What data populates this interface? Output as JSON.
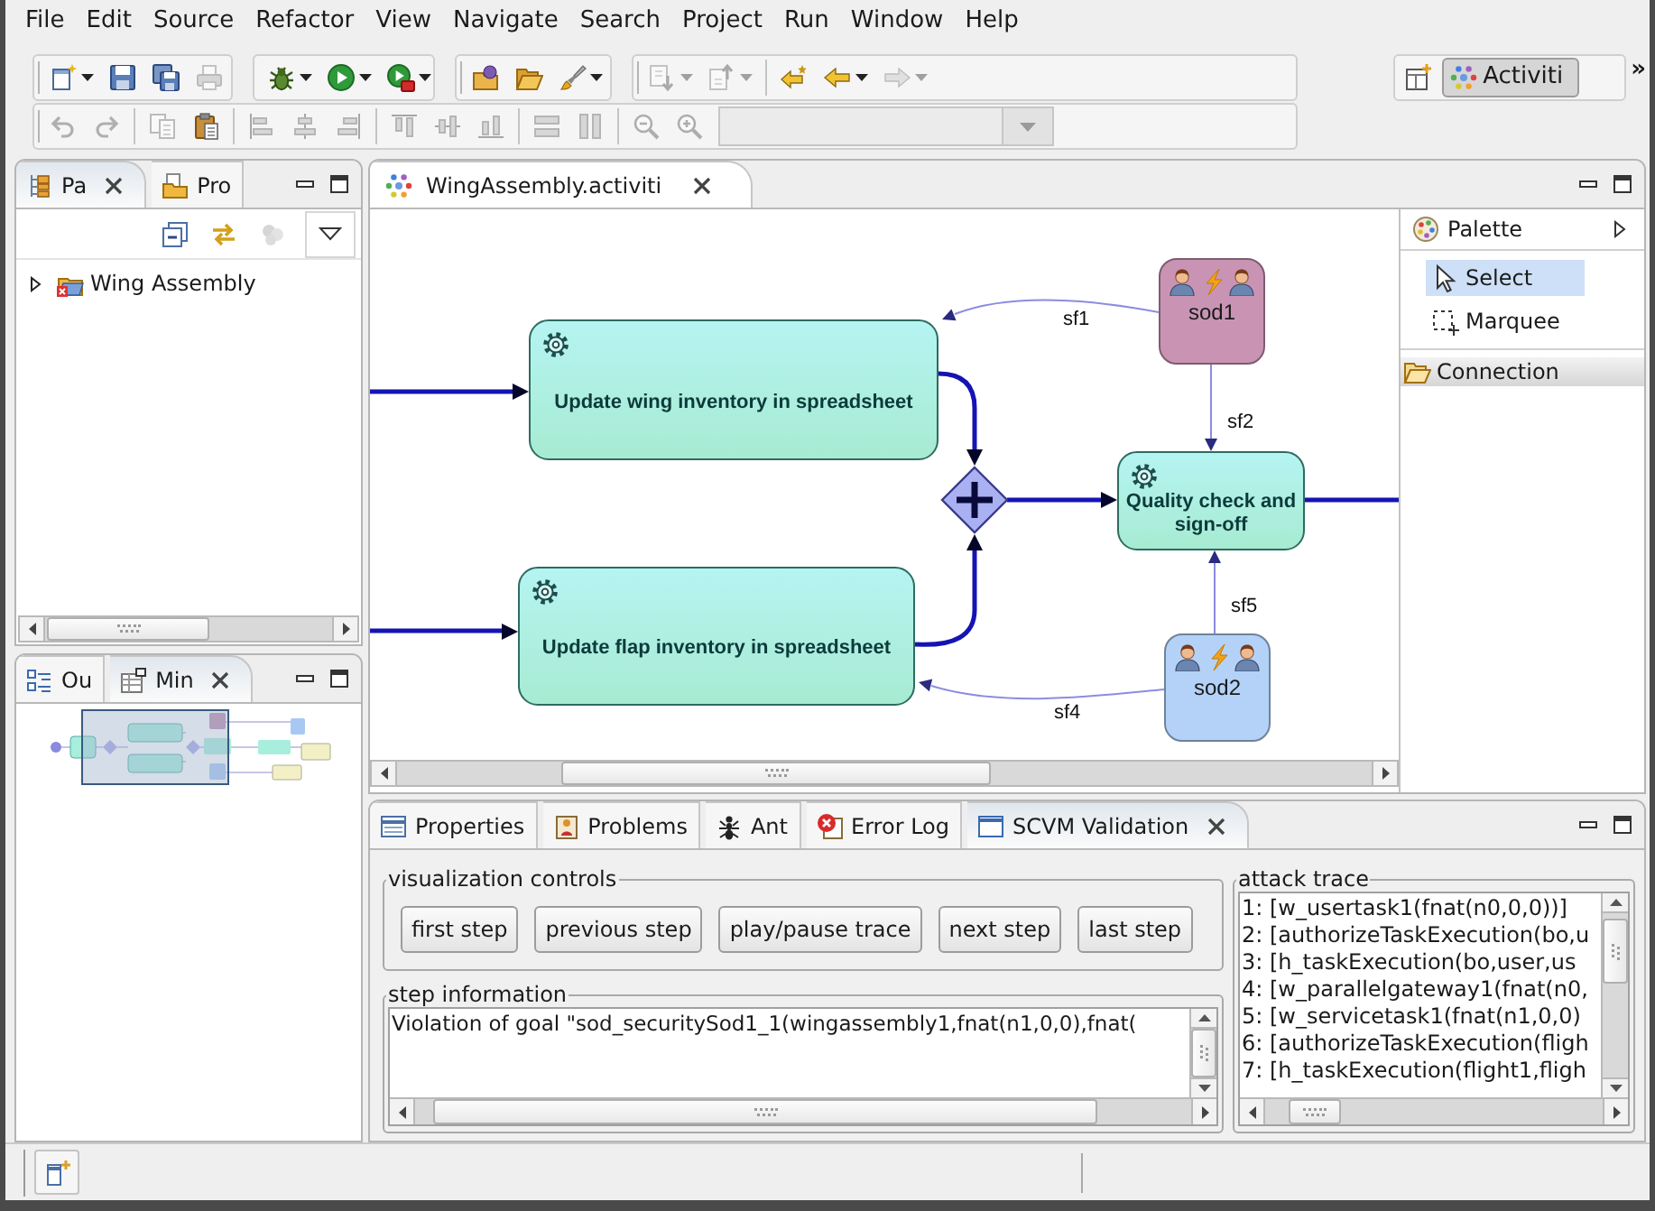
{
  "menu_bar": [
    "File",
    "Edit",
    "Source",
    "Refactor",
    "View",
    "Navigate",
    "Search",
    "Project",
    "Run",
    "Window",
    "Help"
  ],
  "toolbar_rows": [
    [
      {
        "groups": [
          [
            {
              "kind": "new",
              "dropdown": true,
              "disabled": false
            },
            {
              "kind": "save",
              "dropdown": false,
              "disabled": false
            },
            {
              "kind": "save-all",
              "dropdown": false,
              "disabled": false
            },
            {
              "kind": "print",
              "dropdown": false,
              "disabled": true
            }
          ]
        ]
      },
      {
        "groups": [
          [
            {
              "kind": "debug",
              "dropdown": true,
              "disabled": false
            },
            {
              "kind": "run",
              "dropdown": true,
              "disabled": false
            },
            {
              "kind": "external-tools",
              "dropdown": true,
              "disabled": false
            }
          ]
        ]
      },
      {
        "groups": [
          [
            {
              "kind": "open-type",
              "dropdown": false,
              "disabled": false
            },
            {
              "kind": "open-folder",
              "dropdown": false,
              "disabled": false
            },
            {
              "kind": "brush",
              "dropdown": true,
              "disabled": false
            }
          ]
        ]
      },
      {
        "groups": [
          [
            {
              "kind": "next-annotation",
              "dropdown": true,
              "disabled": true
            },
            {
              "kind": "previous-annotation",
              "dropdown": true,
              "disabled": true
            }
          ],
          [
            {
              "kind": "last-edit",
              "dropdown": false,
              "disabled": false
            },
            {
              "kind": "back",
              "dropdown": true,
              "disabled": false
            },
            {
              "kind": "forward",
              "dropdown": true,
              "disabled": true
            }
          ]
        ]
      }
    ],
    [
      {
        "groups": [
          [
            {
              "kind": "undo",
              "dropdown": false,
              "disabled": true
            },
            {
              "kind": "redo",
              "dropdown": false,
              "disabled": true
            }
          ],
          [
            {
              "kind": "copy",
              "dropdown": false,
              "disabled": true
            },
            {
              "kind": "paste",
              "dropdown": false,
              "disabled": false
            }
          ],
          [
            {
              "kind": "align-left",
              "dropdown": false,
              "disabled": true
            },
            {
              "kind": "align-center",
              "dropdown": false,
              "disabled": true
            },
            {
              "kind": "align-right",
              "dropdown": false,
              "disabled": true
            }
          ],
          [
            {
              "kind": "align-top",
              "dropdown": false,
              "disabled": true
            },
            {
              "kind": "align-middle",
              "dropdown": false,
              "disabled": true
            },
            {
              "kind": "align-bottom",
              "dropdown": false,
              "disabled": true
            }
          ],
          [
            {
              "kind": "match-width",
              "dropdown": false,
              "disabled": true
            },
            {
              "kind": "match-height",
              "dropdown": false,
              "disabled": true
            }
          ],
          [
            {
              "kind": "zoom-out",
              "dropdown": false,
              "disabled": true
            },
            {
              "kind": "zoom-in",
              "dropdown": false,
              "disabled": true
            },
            {
              "kind": "combo",
              "disabled": true
            }
          ]
        ]
      }
    ]
  ],
  "perspective_bar": {
    "perspectives": [
      {
        "label": "Activiti",
        "selected": true
      }
    ],
    "overflow": "»"
  },
  "package_explorer": {
    "tabs": [
      {
        "kind": "package",
        "label": "Pa",
        "selected": true
      },
      {
        "kind": "project",
        "label": "Pro",
        "selected": false
      }
    ],
    "tools": [
      {
        "kind": "collapse-all",
        "disabled": false
      },
      {
        "kind": "link",
        "disabled": false
      },
      {
        "kind": "filter",
        "disabled": true
      },
      {
        "kind": "view-menu",
        "disabled": false
      }
    ],
    "tree": [
      {
        "label": "Wing Assembly",
        "expanded": false
      }
    ]
  },
  "outline_view": {
    "tabs": [
      {
        "kind": "outline",
        "label": "Ou",
        "selected": false
      },
      {
        "kind": "minimap",
        "label": "Min",
        "selected": true
      }
    ]
  },
  "editor": {
    "tab": {
      "label": "WingAssembly.activiti",
      "selected": true
    },
    "diagram": {
      "nodes": [
        {
          "kind": "sod",
          "label": "sod1",
          "color": "#c994b4"
        },
        {
          "kind": "task",
          "label": "Update wing inventory in spreadsheet"
        },
        {
          "kind": "task",
          "label": "Quality check and sign-off"
        },
        {
          "kind": "gateway"
        },
        {
          "kind": "task",
          "label": "Update flap inventory in spreadsheet"
        },
        {
          "kind": "sod",
          "label": "sod2",
          "color": "#b4d2f8"
        }
      ],
      "connections": [
        {
          "kind": "sequence"
        },
        {
          "kind": "sequence"
        },
        {
          "kind": "sequence"
        },
        {
          "kind": "sequence"
        },
        {
          "kind": "sequence"
        },
        {
          "kind": "sequence"
        },
        {
          "kind": "association",
          "label": "sf1"
        },
        {
          "kind": "association",
          "label": "sf2"
        },
        {
          "kind": "association",
          "label": "sf5"
        },
        {
          "kind": "association",
          "label": "sf4"
        }
      ]
    },
    "palette": {
      "title": "Palette",
      "tools": [
        {
          "kind": "select",
          "label": "Select",
          "selected": true
        },
        {
          "kind": "marquee",
          "label": "Marquee",
          "selected": false
        }
      ],
      "drawers": [
        {
          "label": "Connection"
        }
      ]
    }
  },
  "bottom_panel": {
    "tabs": [
      {
        "kind": "properties",
        "label": "Properties",
        "selected": false
      },
      {
        "kind": "problems",
        "label": "Problems",
        "selected": false
      },
      {
        "kind": "ant",
        "label": "Ant",
        "selected": false
      },
      {
        "kind": "error-log",
        "label": "Error Log",
        "selected": false
      },
      {
        "kind": "validation",
        "label": "SCVM Validation",
        "selected": true
      }
    ],
    "controls": {
      "title": "visualization controls",
      "buttons": [
        "first step",
        "previous step",
        "play/pause trace",
        "next step",
        "last step"
      ]
    },
    "step_information": {
      "title": "step information",
      "text": "Violation of goal \"sod_securitySod1_1(wingassembly1,fnat(n1,0,0),fnat("
    },
    "attack_trace": {
      "title": "attack trace",
      "lines": [
        "1: [w_usertask1(fnat(n0,0,0))]",
        "2: [authorizeTaskExecution(bo,u",
        "3: [h_taskExecution(bo,user,us",
        "4: [w_parallelgateway1(fnat(n0,",
        "5: [w_servicetask1(fnat(n1,0,0)",
        "6: [authorizeTaskExecution(fligh",
        "7: [h_taskExecution(flight1,fligh"
      ]
    }
  }
}
